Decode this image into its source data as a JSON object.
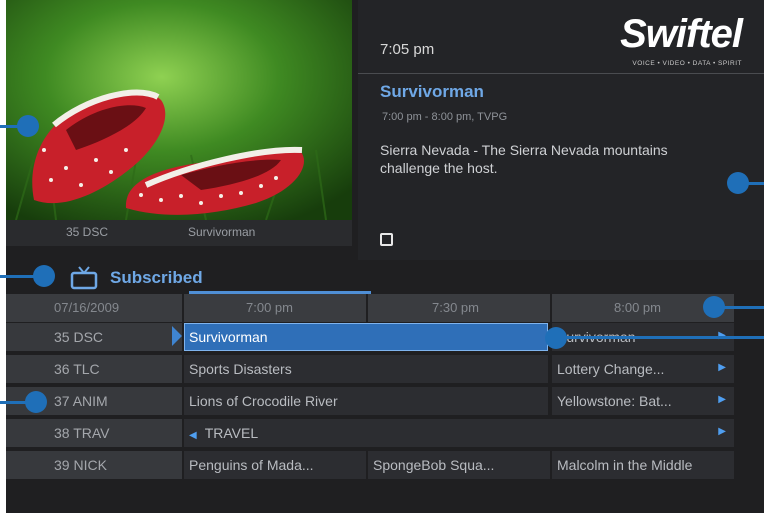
{
  "preview": {
    "channel": "35 DSC",
    "program": "Survivorman"
  },
  "info": {
    "time": "7:05 pm",
    "logo": "Swiftel",
    "logo_sub": "VOICE • VIDEO • DATA • SPIRIT",
    "title": "Survivorman",
    "meta": "7:00 pm - 8:00 pm, TVPG",
    "description": "Sierra Nevada - The Sierra Nevada mountains challenge the host."
  },
  "filter": {
    "label": "Subscribed",
    "icon": "tv-icon"
  },
  "grid": {
    "date": "07/16/2009",
    "times": [
      "7:00 pm",
      "7:30 pm",
      "8:00 pm"
    ],
    "rows": [
      {
        "channel": "35 DSC",
        "cells": [
          "Survivorman",
          "Survivorman"
        ]
      },
      {
        "channel": "36 TLC",
        "cells": [
          "Sports Disasters",
          "Lottery Change..."
        ]
      },
      {
        "channel": "37 ANIM",
        "cells": [
          "Lions of Crocodile River",
          "Yellowstone: Bat..."
        ]
      },
      {
        "channel": "38 TRAV",
        "cells": [
          "TRAVEL"
        ]
      },
      {
        "channel": "39 NICK",
        "cells": [
          "Penguins of Mada...",
          "SpongeBob Squa...",
          "Malcolm in the Middle"
        ]
      }
    ]
  },
  "colors": {
    "accent": "#6fa8e6",
    "selected": "#2f6fb8",
    "callout": "#1f6fb8",
    "background": "#1f1f21"
  }
}
